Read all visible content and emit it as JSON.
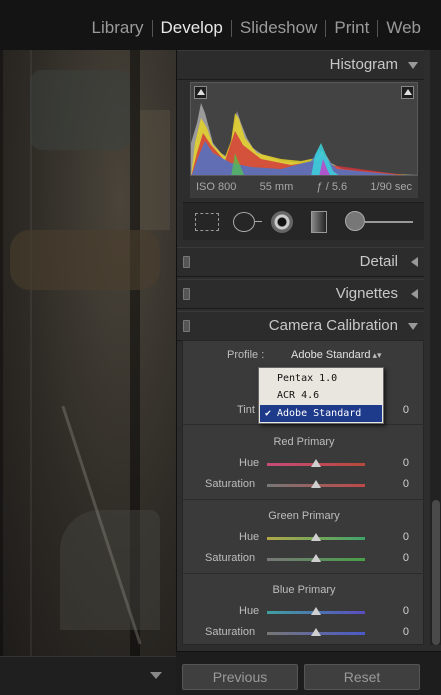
{
  "modules": {
    "items": [
      {
        "label": "Library",
        "active": false
      },
      {
        "label": "Develop",
        "active": true
      },
      {
        "label": "Slideshow",
        "active": false
      },
      {
        "label": "Print",
        "active": false
      },
      {
        "label": "Web",
        "active": false
      }
    ]
  },
  "histogram": {
    "title": "Histogram",
    "iso": "ISO 800",
    "focal": "55 mm",
    "aperture": "ƒ / 5.6",
    "shutter": "1/90 sec"
  },
  "panels": {
    "detail": "Detail",
    "vignettes": "Vignettes",
    "calibration": "Camera Calibration"
  },
  "calibration": {
    "profile_label": "Profile :",
    "profile_value": "Adobe Standard",
    "tint_label": "Tint",
    "tint_value": "0",
    "profile_menu": [
      {
        "label": "Pentax 1.0",
        "selected": false
      },
      {
        "label": "ACR 4.6",
        "selected": false
      },
      {
        "label": "Adobe Standard",
        "selected": true
      }
    ],
    "check": "✔",
    "groups": [
      {
        "title": "Red Primary",
        "hue_label": "Hue",
        "hue_value": "0",
        "sat_label": "Saturation",
        "sat_value": "0",
        "hue_colors": [
          "#c84b7a",
          "#b64a3a"
        ],
        "sat_colors": [
          "#777777",
          "#c04848"
        ]
      },
      {
        "title": "Green Primary",
        "hue_label": "Hue",
        "hue_value": "0",
        "sat_label": "Saturation",
        "sat_value": "0",
        "hue_colors": [
          "#b2a84a",
          "#3fa36a"
        ],
        "sat_colors": [
          "#777777",
          "#48a048"
        ]
      },
      {
        "title": "Blue Primary",
        "hue_label": "Hue",
        "hue_value": "0",
        "sat_label": "Saturation",
        "sat_value": "0",
        "hue_colors": [
          "#3fa0a0",
          "#5a4cc0"
        ],
        "sat_colors": [
          "#777777",
          "#4a5ac8"
        ]
      }
    ]
  },
  "buttons": {
    "previous": "Previous",
    "reset": "Reset"
  },
  "icons": {
    "crop": "crop-overlay-icon",
    "spot": "spot-removal-icon",
    "redeye": "red-eye-icon",
    "graduated": "graduated-filter-icon",
    "brush": "adjustment-brush-icon"
  }
}
